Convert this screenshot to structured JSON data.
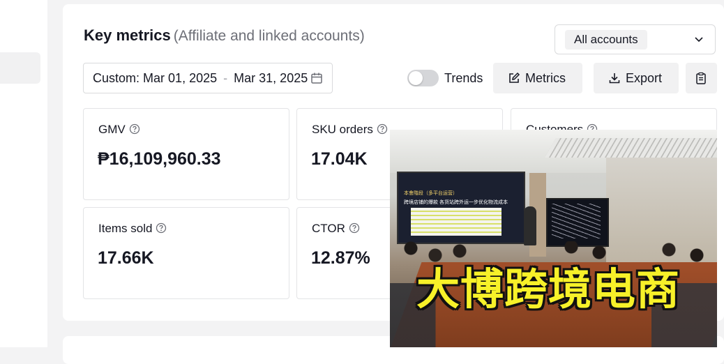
{
  "header": {
    "title": "Key metrics",
    "subtitle": "(Affiliate and linked accounts)"
  },
  "account_select": {
    "value": "All accounts"
  },
  "date_range": {
    "prefix": "Custom:",
    "start": "Mar 01, 2025",
    "separator": "-",
    "end": "Mar 31, 2025"
  },
  "controls": {
    "trends_label": "Trends",
    "trends_on": false,
    "metrics_label": "Metrics",
    "export_label": "Export"
  },
  "metrics": [
    {
      "label": "GMV",
      "value": "₱16,109,960.33"
    },
    {
      "label": "SKU orders",
      "value": "17.04K"
    },
    {
      "label": "Customers",
      "value": ""
    },
    {
      "label": "Items sold",
      "value": "17.66K"
    },
    {
      "label": "CTOR",
      "value": "12.87%"
    }
  ],
  "overlay": {
    "caption": "大博跨境电商",
    "screen_line_1": "本會階段（多平台运营）",
    "screen_line_2": "跨境店铺的爆款 各货站跨外运一步优化物流成本"
  },
  "colors": {
    "caption_fill": "#f7f129",
    "background": "#f3f3f4",
    "button_bg": "#f1f1f2"
  }
}
